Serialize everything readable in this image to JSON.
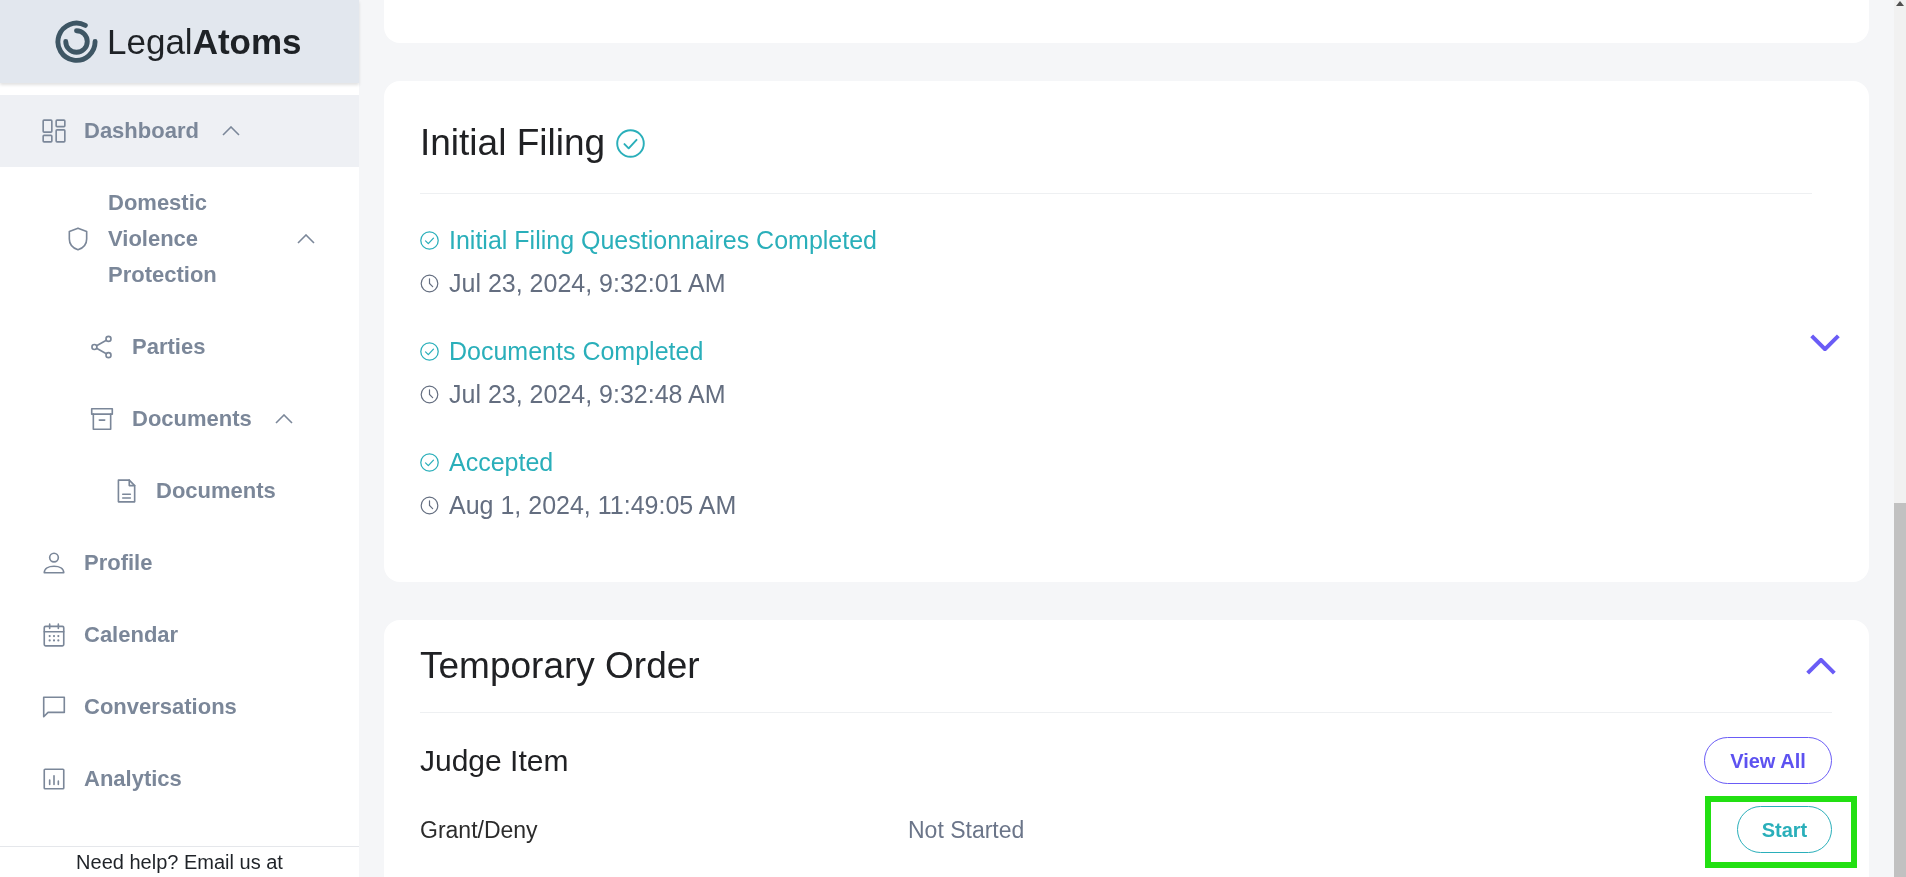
{
  "sidebar": {
    "logo": "Legal**Atoms**",
    "items": [
      {
        "label": "Dashboard",
        "selected": true,
        "expanded": true,
        "children": [
          {
            "label": "Domestic Violence Protection",
            "selected": false,
            "expanded": true,
            "children": [
              {
                "label": "Parties",
                "selected": false
              },
              {
                "label": "Documents",
                "selected": false,
                "expanded": true,
                "children": [
                  {
                    "label": "Documents",
                    "selected": false
                  }
                ]
              }
            ]
          }
        ]
      },
      {
        "label": "Profile",
        "selected": false
      },
      {
        "label": "Calendar",
        "selected": false
      },
      {
        "label": "Conversations",
        "selected": false
      },
      {
        "label": "Analytics",
        "selected": false
      }
    ],
    "help_text": "Need help? Email us at"
  },
  "sections": [
    {
      "kind": "timeline",
      "title": "Initial Filing",
      "completed": true,
      "expanded": false,
      "events": [
        {
          "status": "Initial Filing Questionnaires Completed",
          "time": "Jul 23, 2024, 9:32:01 AM"
        },
        {
          "status": "Documents Completed",
          "time": "Jul 23, 2024, 9:32:48 AM"
        },
        {
          "status": "Accepted",
          "time": "Aug 1, 2024, 11:49:05 AM"
        }
      ]
    },
    {
      "kind": "tasks",
      "title": "Temporary Order",
      "expanded": true,
      "groups": [
        {
          "title": "Judge Item",
          "button": "View All",
          "tasks": [
            {
              "name": "Grant/Deny",
              "status": "Not Started",
              "action": "Start",
              "highlighted": true
            }
          ]
        }
      ]
    }
  ]
}
